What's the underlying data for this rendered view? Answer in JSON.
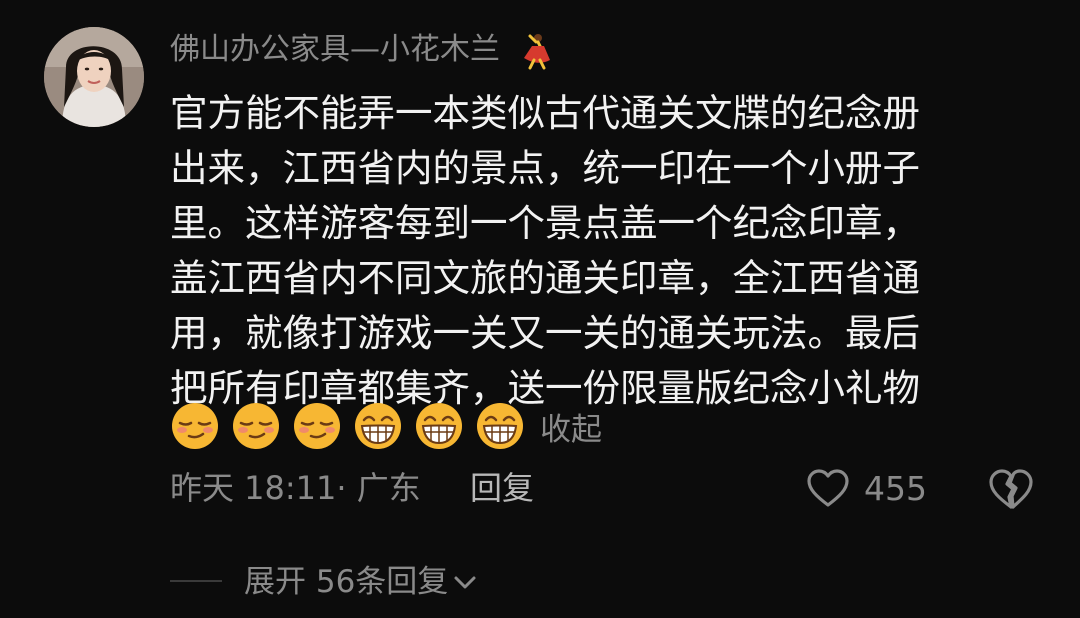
{
  "comment": {
    "username": "佛山办公家具—小花木兰",
    "name_emoji": "dancer-icon",
    "text": "官方能不能弄一本类似古代通关文牒的纪念册\n出来，江西省内的景点，统一印在一个小册子\n里。这样游客每到一个景点盖一个纪念印章，\n盖江西省内不同文旅的通关印章，全江西省通\n用，就像打游戏一关又一关的通关玩法。最后\n把所有印章都集齐，送一份限量版纪念小礼物",
    "emojis": [
      "smirk-icon",
      "smirk-icon",
      "smirk-icon",
      "grin-icon",
      "grin-icon",
      "grin-icon"
    ],
    "collapse_label": "收起",
    "meta": "昨天 18:11· 广东",
    "reply_label": "回复",
    "like_count": "455",
    "expand_label": "展开 56条回复"
  },
  "colors": {
    "background": "#0c0c0c",
    "primary_text": "#f2f2f2",
    "secondary_text": "#8a8a8a",
    "emoji_yellow": "#f7b733"
  }
}
